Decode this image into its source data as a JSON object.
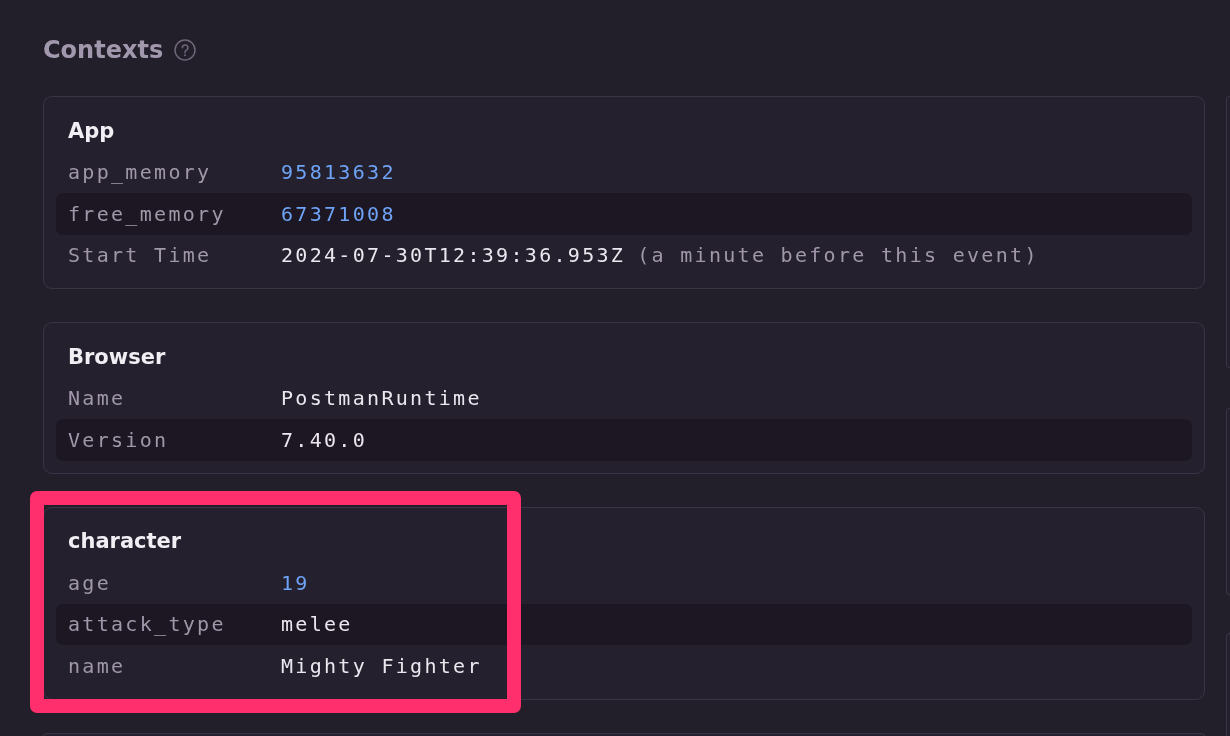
{
  "section": {
    "title": "Contexts"
  },
  "contexts": [
    {
      "title": "App",
      "highlighted": false,
      "rows": [
        {
          "key": "app_memory",
          "value": "95813632",
          "kind": "number"
        },
        {
          "key": "free_memory",
          "value": "67371008",
          "kind": "number"
        },
        {
          "key": "Start Time",
          "value": "2024-07-30T12:39:36.953Z",
          "kind": "text",
          "note": "(a minute before this event)"
        }
      ]
    },
    {
      "title": "Browser",
      "highlighted": false,
      "rows": [
        {
          "key": "Name",
          "value": "PostmanRuntime",
          "kind": "text"
        },
        {
          "key": "Version",
          "value": "7.40.0",
          "kind": "text"
        }
      ]
    },
    {
      "title": "character",
      "highlighted": true,
      "rows": [
        {
          "key": "age",
          "value": "19",
          "kind": "number"
        },
        {
          "key": "attack_type",
          "value": "melee",
          "kind": "text"
        },
        {
          "key": "name",
          "value": "Mighty Fighter",
          "kind": "text"
        }
      ]
    }
  ]
}
